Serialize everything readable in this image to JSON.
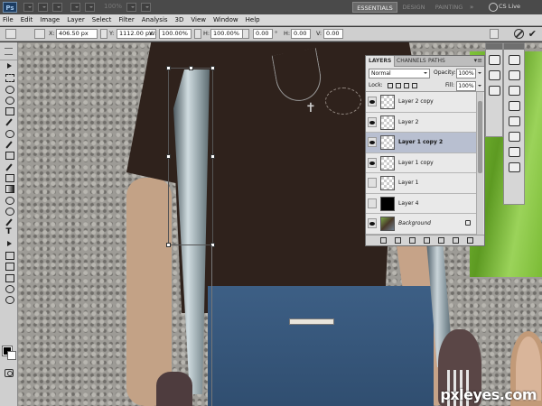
{
  "app": {
    "logo_text": "Ps",
    "zoom": "100%",
    "workspaces": [
      "ESSENTIALS",
      "DESIGN",
      "PAINTING"
    ],
    "workspaces_more": "»",
    "cs_live": "CS Live"
  },
  "menu": [
    "File",
    "Edit",
    "Image",
    "Layer",
    "Select",
    "Filter",
    "Analysis",
    "3D",
    "View",
    "Window",
    "Help"
  ],
  "options": {
    "x_label": "X:",
    "x_value": "406.50 px",
    "y_label": "Y:",
    "y_value": "1112.00 px",
    "w_label": "W:",
    "w_value": "100.00%",
    "h_label": "H:",
    "h_value": "100.00%",
    "angle_value": "0.00",
    "angle_unit": "°",
    "hskew_label": "H:",
    "hskew_value": "0.00",
    "vskew_label": "V:",
    "vskew_value": "0.00"
  },
  "layers_panel": {
    "tabs": [
      "LAYERS",
      "CHANNELS",
      "PATHS"
    ],
    "menu_glyph": "▾≡",
    "blend_mode": "Normal",
    "opacity_label": "Opacity:",
    "opacity_value": "100%",
    "lock_label": "Lock:",
    "fill_label": "Fill:",
    "fill_value": "100%",
    "layers": [
      {
        "name": "Layer 2 copy",
        "visible": true,
        "thumb": "transparent"
      },
      {
        "name": "Layer 2",
        "visible": true,
        "thumb": "transparent"
      },
      {
        "name": "Layer 1 copy 2",
        "visible": true,
        "thumb": "transparent",
        "selected": true
      },
      {
        "name": "Layer 1 copy",
        "visible": true,
        "thumb": "transparent"
      },
      {
        "name": "Layer 1",
        "visible": false,
        "thumb": "transparent"
      },
      {
        "name": "Layer 4",
        "visible": false,
        "thumb": "black"
      },
      {
        "name": "Background",
        "visible": true,
        "thumb": "photo",
        "locked": true
      }
    ]
  },
  "watermark": "pxleyes.com"
}
